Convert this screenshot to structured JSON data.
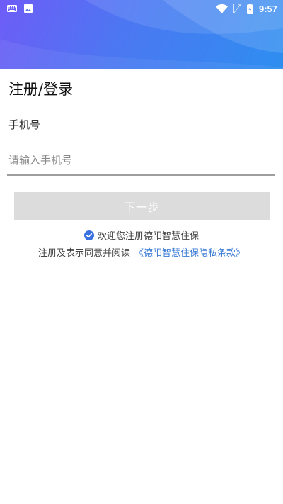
{
  "status_bar": {
    "time": "9:57",
    "icons": [
      "keyboard-icon",
      "image-icon",
      "wifi-icon",
      "no-sim-icon",
      "battery-charging-icon"
    ]
  },
  "page": {
    "title": "注册/登录",
    "phone_label": "手机号",
    "phone_input": {
      "placeholder": "请输入手机号",
      "value": ""
    },
    "next_button": "下一步",
    "welcome_text": "欢迎您注册德阳智慧住保",
    "agree_prefix": "注册及表示同意并阅读",
    "privacy_link": "《德阳智慧住保隐私条款》"
  },
  "colors": {
    "header_start": "#6e5cf6",
    "header_end": "#2e8ef0",
    "button_disabled": "#dcdcdc",
    "link": "#3a7bd5",
    "check": "#3a6fe0"
  }
}
